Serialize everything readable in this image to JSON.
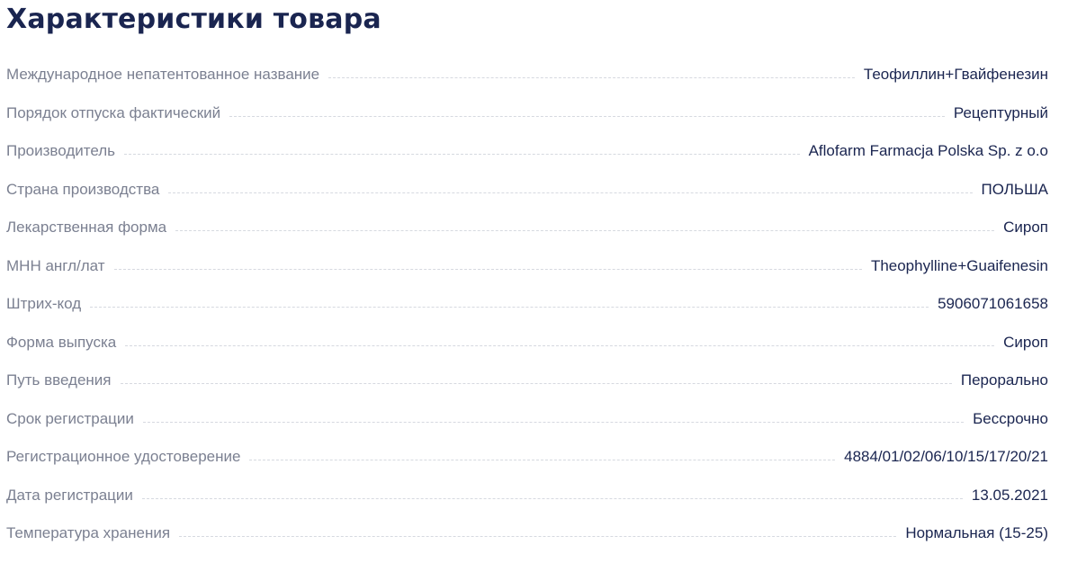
{
  "section": {
    "title": "Характеристики товара"
  },
  "specs": [
    {
      "label": "Международное непатентованное название",
      "value": "Теофиллин+Гвайфенезин"
    },
    {
      "label": "Порядок отпуска фактический",
      "value": "Рецептурный"
    },
    {
      "label": "Производитель",
      "value": "Aflofarm Farmacja Polska Sp. z o.o"
    },
    {
      "label": "Страна производства",
      "value": "ПОЛЬША"
    },
    {
      "label": "Лекарственная форма",
      "value": "Сироп"
    },
    {
      "label": "МНН англ/лат",
      "value": "Theophylline+Guaifenesin"
    },
    {
      "label": "Штрих-код",
      "value": "5906071061658"
    },
    {
      "label": "Форма выпуска",
      "value": "Сироп"
    },
    {
      "label": "Путь введения",
      "value": "Перорально"
    },
    {
      "label": "Срок регистрации",
      "value": "Бессрочно"
    },
    {
      "label": "Регистрационное удостоверение",
      "value": "4884/01/02/06/10/15/17/20/21"
    },
    {
      "label": "Дата регистрации",
      "value": "13.05.2021"
    },
    {
      "label": "Температура хранения",
      "value": "Нормальная (15-25)"
    }
  ]
}
